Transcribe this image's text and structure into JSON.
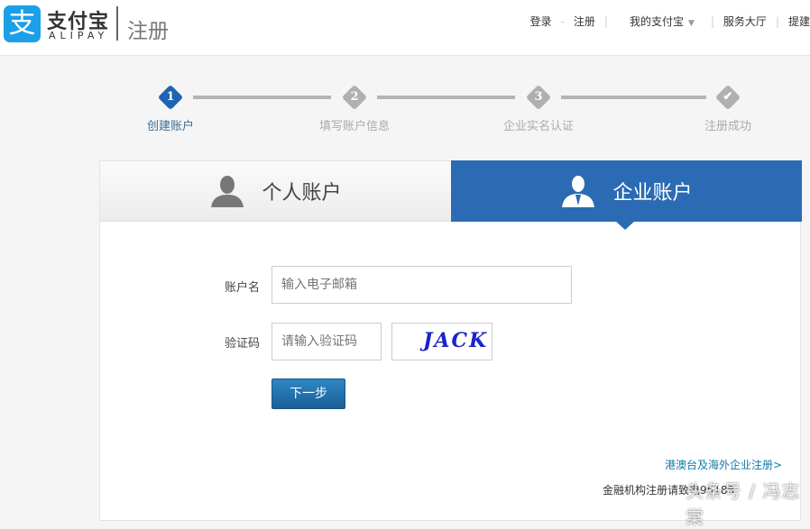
{
  "header": {
    "logo_glyph": "支",
    "brand": "支付宝",
    "brand_en": "ALIPAY",
    "page_title": "注册",
    "nav": {
      "login": "登录",
      "dash": "-",
      "register": "注册",
      "my_alipay": "我的支付宝",
      "service_hall": "服务大厅",
      "suggest": "提建"
    }
  },
  "steps": [
    {
      "num": "1",
      "label": "创建账户",
      "active": true
    },
    {
      "num": "2",
      "label": "填写账户信息",
      "active": false
    },
    {
      "num": "3",
      "label": "企业实名认证",
      "active": false
    },
    {
      "num": "✔",
      "label": "注册成功",
      "active": false
    }
  ],
  "tabs": {
    "personal": "个人账户",
    "business": "企业账户"
  },
  "form": {
    "account_label": "账户名",
    "account_placeholder": "输入电子邮箱",
    "captcha_label": "验证码",
    "captcha_placeholder": "请输入验证码",
    "captcha_image_text": "JACK",
    "next_button": "下一步"
  },
  "links": {
    "overseas": "港澳台及海外企业注册>",
    "financial": "金融机构注册请致电95188"
  },
  "watermark": "头条号 / 冯志棠",
  "colors": {
    "brand_blue": "#1ba0e8",
    "tab_active": "#2a6bb4",
    "link": "#0e7aa8"
  }
}
